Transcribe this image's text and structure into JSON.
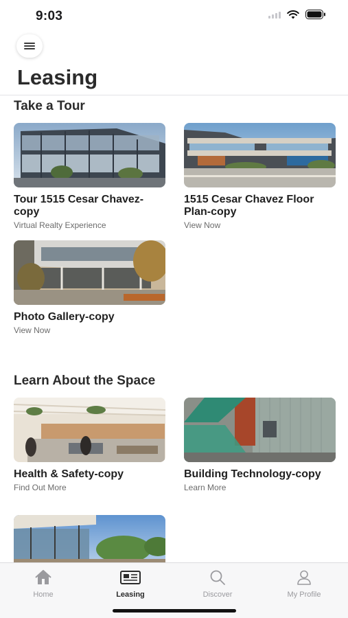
{
  "status_bar": {
    "time": "9:03"
  },
  "header": {
    "title": "Leasing"
  },
  "sections": [
    {
      "title": "Take a Tour",
      "cards": [
        {
          "title": "Tour 1515 Cesar Chavez-copy",
          "subtitle": "Virtual Realty Experience"
        },
        {
          "title": "1515 Cesar Chavez Floor Plan-copy",
          "subtitle": "View Now"
        },
        {
          "title": "Photo Gallery-copy",
          "subtitle": "View Now"
        }
      ]
    },
    {
      "title": "Learn About the Space",
      "cards": [
        {
          "title": "Health & Safety-copy",
          "subtitle": "Find Out More"
        },
        {
          "title": "Building Technology-copy",
          "subtitle": "Learn More"
        }
      ]
    }
  ],
  "tab_bar": {
    "tabs": [
      {
        "label": "Home",
        "icon": "home-icon",
        "active": false
      },
      {
        "label": "Leasing",
        "icon": "newspaper-icon",
        "active": true
      },
      {
        "label": "Discover",
        "icon": "search-icon",
        "active": false
      },
      {
        "label": "My Profile",
        "icon": "person-icon",
        "active": false
      }
    ]
  },
  "colors": {
    "active_tab": "#2b2b2b",
    "inactive_tab": "#9a9a9e",
    "tab_bar_bg": "#f7f7f8"
  }
}
